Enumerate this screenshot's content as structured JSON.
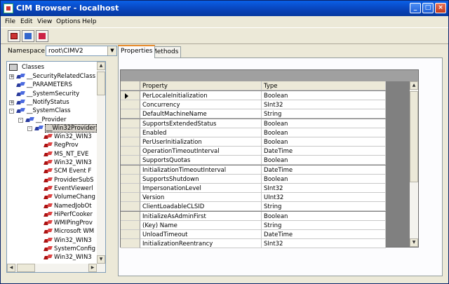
{
  "window": {
    "title": "CIM Browser - localhost"
  },
  "menu": [
    "File",
    "Edit",
    "View",
    "Options",
    "Help"
  ],
  "namespace": {
    "label": "Namespace",
    "value": "root\\CIMV2"
  },
  "tabs": [
    "Properties",
    "Methods"
  ],
  "tree": {
    "root": "Classes",
    "items": [
      {
        "label": "__SecurityRelatedClass",
        "expander": "+"
      },
      {
        "label": "__PARAMETERS"
      },
      {
        "label": "__SystemSecurity"
      },
      {
        "label": "__NotifyStatus",
        "expander": "+"
      },
      {
        "label": "__SystemClass",
        "expander": "-"
      },
      {
        "label": "__Provider",
        "expander": "-"
      },
      {
        "label": "__Win32Provider",
        "expander": "-",
        "selected": true
      },
      {
        "label": "Win32_WIN3"
      },
      {
        "label": "RegProv"
      },
      {
        "label": "MS_NT_EVE"
      },
      {
        "label": "Win32_WIN3"
      },
      {
        "label": "SCM Event F"
      },
      {
        "label": "ProviderSubS"
      },
      {
        "label": "EventViewerl"
      },
      {
        "label": "VolumeChang"
      },
      {
        "label": "NamedJobOt"
      },
      {
        "label": "HiPerfCooker"
      },
      {
        "label": "WMIPingProv"
      },
      {
        "label": "Microsoft WM"
      },
      {
        "label": "Win32_WIN3"
      },
      {
        "label": "SystemConfig"
      },
      {
        "label": "Win32_WIN3"
      }
    ]
  },
  "grid": {
    "columns": [
      "Property",
      "Type"
    ],
    "rows": [
      [
        "PerLocaleInitialization",
        "Boolean"
      ],
      [
        "Concurrency",
        "SInt32"
      ],
      [
        "DefaultMachineName",
        "String"
      ],
      [
        "SupportsExtendedStatus",
        "Boolean"
      ],
      [
        "Enabled",
        "Boolean"
      ],
      [
        "PerUserInitialization",
        "Boolean"
      ],
      [
        "OperationTimeoutInterval",
        "DateTime"
      ],
      [
        "SupportsQuotas",
        "Boolean"
      ],
      [
        "InitializationTimeoutInterval",
        "DateTime"
      ],
      [
        "SupportsShutdown",
        "Boolean"
      ],
      [
        "ImpersonationLevel",
        "SInt32"
      ],
      [
        "Version",
        "UInt32"
      ],
      [
        "ClientLoadableCLSID",
        "String"
      ],
      [
        "InitializeAsAdminFirst",
        "Boolean"
      ],
      [
        "(Key) Name",
        "String"
      ],
      [
        "UnloadTimeout",
        "DateTime"
      ],
      [
        "InitializationReentrancy",
        "SInt32"
      ]
    ]
  }
}
